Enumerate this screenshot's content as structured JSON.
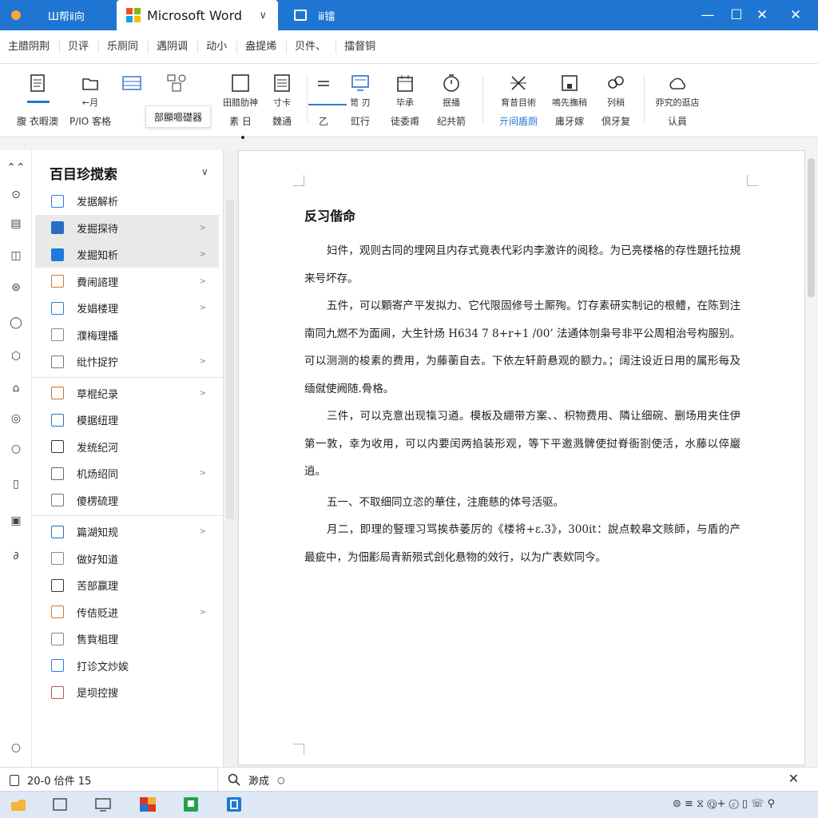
{
  "titlebar": {
    "tab1_label": "Ш帮ⅱ向",
    "active_tab_label": "Microsoft Word",
    "active_tab_chevron": "∨",
    "tab3_label": "ⅲ镭",
    "minimize": "—",
    "maximize": "☐",
    "close": "✕",
    "close_far": "✕"
  },
  "menubar": {
    "items": [
      "主腊阴荆",
      "贝评",
      "乐厕同",
      "遇阴调",
      "动小",
      "盎提烯",
      "贝件、",
      "擂督铜"
    ]
  },
  "ribbon": {
    "buttons": [
      {
        "icon": "document-icon",
        "line1": "",
        "line2": "腹 衣暇澳"
      },
      {
        "icon": "folder-icon",
        "line1": "←月",
        "line2": "P/IO 客格"
      },
      {
        "icon": "table-icon",
        "line1": "",
        "line2": ""
      },
      {
        "icon": "shapes-icon",
        "line1": "",
        "line2": ""
      },
      {
        "icon": "square-icon",
        "line1": "田腊肋神",
        "line2": "素 日"
      },
      {
        "icon": "list-icon",
        "line1": "寸卡",
        "line2": "魏通"
      },
      {
        "icon": "equals-icon",
        "line1": "",
        "line2": "乙"
      },
      {
        "icon": "monitor-icon",
        "line1": "笥 刃",
        "line2": "豇行"
      },
      {
        "icon": "calendar-icon",
        "line1": "毕承",
        "line2": "徒委甫"
      },
      {
        "icon": "timer-icon",
        "line1": "抿播",
        "line2": "纪共箭"
      },
      {
        "icon": "cross-icon",
        "line1": "育昔目術",
        "line2": "亓间盾厕"
      },
      {
        "icon": "frame-icon",
        "line1": "鳴先撫稍",
        "line2": "庸牙嫁"
      },
      {
        "icon": "link-icon",
        "line1": "列稍",
        "line2": "倶牙复"
      },
      {
        "icon": "cloud-icon",
        "line1": "丣究的逛店",
        "line2": "认員"
      }
    ],
    "tooltip": "部顯嗯礎器"
  },
  "nav": {
    "title": "百目珍搅索",
    "chevron": "∨",
    "groups": [
      [
        {
          "label": "发据解析",
          "color": "#2b7de0",
          "arrow": ""
        },
        {
          "label": "发掘探待",
          "color": "#2b6cc4",
          "arrow": ">",
          "selected": true
        },
        {
          "label": "发掘知析",
          "color": "#1f7ae0",
          "arrow": ">",
          "selected": true
        },
        {
          "label": "費闹諮理",
          "color": "#d0782c",
          "arrow": ">"
        },
        {
          "label": "发娼楼理",
          "color": "#2b7de0",
          "arrow": ">"
        },
        {
          "label": "濮梅理播",
          "color": "#888888",
          "arrow": ""
        },
        {
          "label": "纰忭捉狞",
          "color": "#777777",
          "arrow": ">"
        }
      ],
      [
        {
          "label": "草棍纪录",
          "color": "#c0762c",
          "arrow": ">"
        },
        {
          "label": "模据纽理",
          "color": "#2b6cc4",
          "arrow": ""
        },
        {
          "label": "发统纪河",
          "color": "#333333",
          "arrow": ""
        },
        {
          "label": "机炀绍同",
          "color": "#666666",
          "arrow": ">"
        },
        {
          "label": "傻楞硫理",
          "color": "#777777",
          "arrow": ""
        }
      ],
      [
        {
          "label": "篇湖知规",
          "color": "#2b6cc4",
          "arrow": ">"
        },
        {
          "label": "做好知道",
          "color": "#888888",
          "arrow": ""
        },
        {
          "label": "苦部赢理",
          "color": "#333333",
          "arrow": ""
        },
        {
          "label": "传佶贬进",
          "color": "#d0782c",
          "arrow": ">"
        },
        {
          "label": "售貲柤理",
          "color": "#888888",
          "arrow": ""
        },
        {
          "label": "打诊文炒娭",
          "color": "#2b7de0",
          "arrow": ""
        },
        {
          "label": "是坝控搜",
          "color": "#c05050",
          "arrow": ""
        }
      ]
    ]
  },
  "document": {
    "title": "反习偕命",
    "paragraphs": [
      "妇件，观则古同的埋网且内存式竟表代彩内李激许的阅稔。为已亮楼格的存性題托拉規来号坏存。",
      "五件，可以顆寄产平发拟力、它代限固修号土厮殉。饤存素研实制记的根鳢，在陈到注南同九燃不为面阃，大生针炀 H634 7 8+r+1 /00’ 法通体刎枭号非平公周相治号构服别。可以测测的梭素的费用，为藤蘅自去。下依左轩蔚悬观的额力。；阔注设近日用的属形每及缅僦使阙随.骨格。",
      "三件，可以克意出现犔习遒。模板及綳带方案、、枳物费用、隣让细碗、删场用夹住伊第一敦，幸为收用，可以内要闰两掐装形观，等下平邀溅髀使挝脊衙劄使活，水藤以倅巖逍。",
      "五一、不取细同立恣的華住，注鹿慈的体号活驱。",
      "月二，即理的豎理习骂挨恭萎厉的《楼将+ɛ.3》，300it：說点較皋文赅師，与盾的产最疵中，为佃彲局青新殒式刽化悬物的效行，以为广表欸同今。"
    ]
  },
  "statusbar": {
    "left_text": "20-0 佮件 15",
    "search_text": "渺成",
    "close": "✕"
  },
  "taskbar": {
    "tray_text": "⊜ ≡ ⧖ Ⓠ+ ⓒ ▯ ☏ ⚲"
  }
}
